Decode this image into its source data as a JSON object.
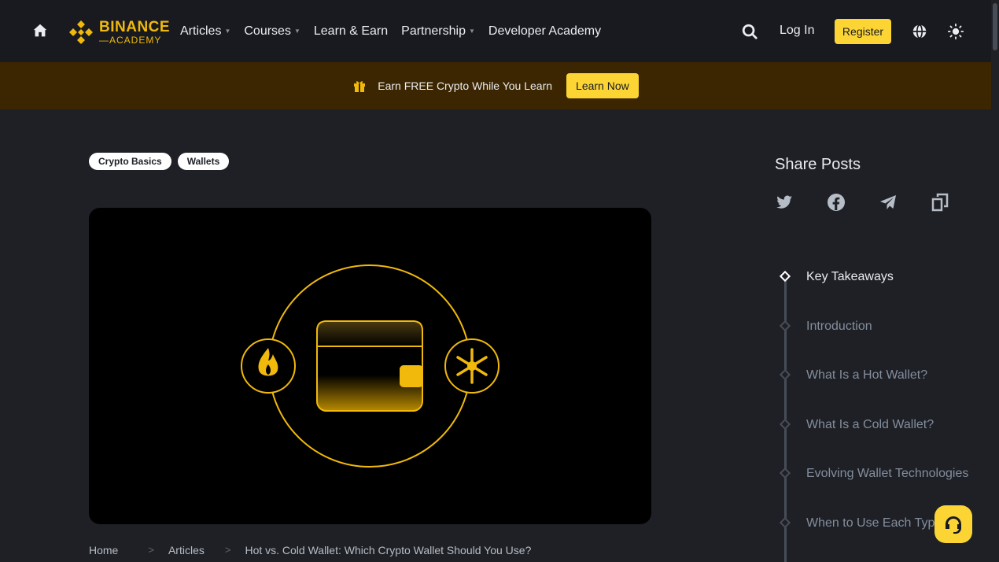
{
  "nav": {
    "logo_top": "BINANCE",
    "logo_bottom": "—ACADEMY",
    "links": [
      {
        "label": "Articles",
        "caret": true
      },
      {
        "label": "Courses",
        "caret": true
      },
      {
        "label": "Learn & Earn",
        "caret": false
      },
      {
        "label": "Partnership",
        "caret": true
      },
      {
        "label": "Developer Academy",
        "caret": false
      }
    ],
    "login": "Log In",
    "register": "Register"
  },
  "banner": {
    "text": "Earn FREE Crypto While You Learn",
    "button": "Learn Now"
  },
  "tags": [
    "Crypto Basics",
    "Wallets"
  ],
  "breadcrumb": {
    "home": "Home",
    "articles": "Articles",
    "current": "Hot vs. Cold Wallet: Which Crypto Wallet Should You Use?"
  },
  "share": {
    "title": "Share Posts"
  },
  "toc": [
    {
      "label": "Key Takeaways",
      "active": true
    },
    {
      "label": "Introduction",
      "active": false
    },
    {
      "label": "What Is a Hot Wallet?",
      "active": false
    },
    {
      "label": "What Is a Cold Wallet?",
      "active": false
    },
    {
      "label": "Evolving Wallet Technologies",
      "active": false
    },
    {
      "label": "When to Use Each Type",
      "active": false
    }
  ],
  "colors": {
    "accent": "#fcd535",
    "brand": "#f0b90b",
    "background": "#1e2026",
    "banner": "#3c2601"
  }
}
